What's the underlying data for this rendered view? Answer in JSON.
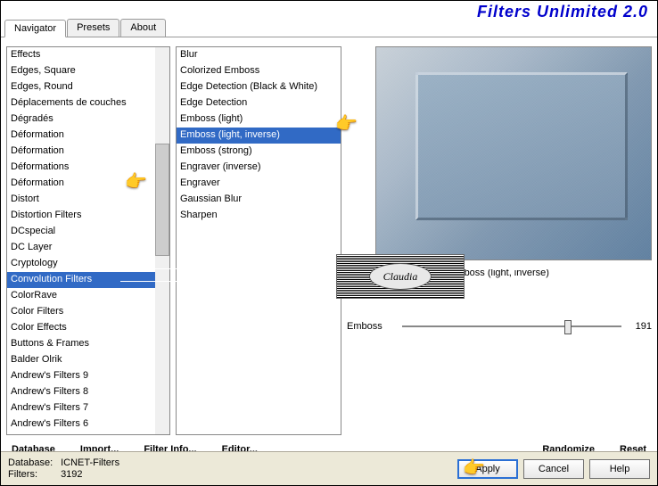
{
  "app": {
    "title": "Filters Unlimited 2.0"
  },
  "tabs": [
    "Navigator",
    "Presets",
    "About"
  ],
  "active_tab": 0,
  "left_list": [
    "Andrew's Filters 6",
    "Andrew's Filters 7",
    "Andrew's Filters 8",
    "Andrew's Filters 9",
    "Balder Olrik",
    "Buttons & Frames",
    "Color Effects",
    "Color Filters",
    "ColorRave",
    "Convolution Filters",
    "Cryptology",
    "DC Layer",
    "DCspecial",
    "Distortion Filters",
    "Distort",
    "Déformation",
    "Déformations",
    "Déformation",
    "Déformation",
    "Dégradés",
    "Déplacements de couches",
    "Edges, Round",
    "Edges, Square",
    "Effects"
  ],
  "left_selected_index": 9,
  "mid_list": [
    "Blur",
    "Colorized Emboss",
    "Edge Detection (Black & White)",
    "Edge Detection",
    "Emboss (light)",
    "Emboss (light, inverse)",
    "Emboss (strong)",
    "Engraver (inverse)",
    "Engraver",
    "Gaussian Blur",
    "Sharpen"
  ],
  "mid_selected_index": 5,
  "preview": {
    "name": "Emboss (light, inverse)",
    "param_label": "Emboss",
    "param_value": "191"
  },
  "commands": {
    "database": "Database",
    "import": "Import...",
    "filter_info": "Filter Info...",
    "editor": "Editor...",
    "randomize": "Randomize",
    "reset": "Reset"
  },
  "status": {
    "db_label": "Database:",
    "db_value": "ICNET-Filters",
    "filters_label": "Filters:",
    "filters_value": "3192"
  },
  "buttons": {
    "apply": "Apply",
    "cancel": "Cancel",
    "help": "Help"
  },
  "logo": {
    "text": "Claudia"
  }
}
